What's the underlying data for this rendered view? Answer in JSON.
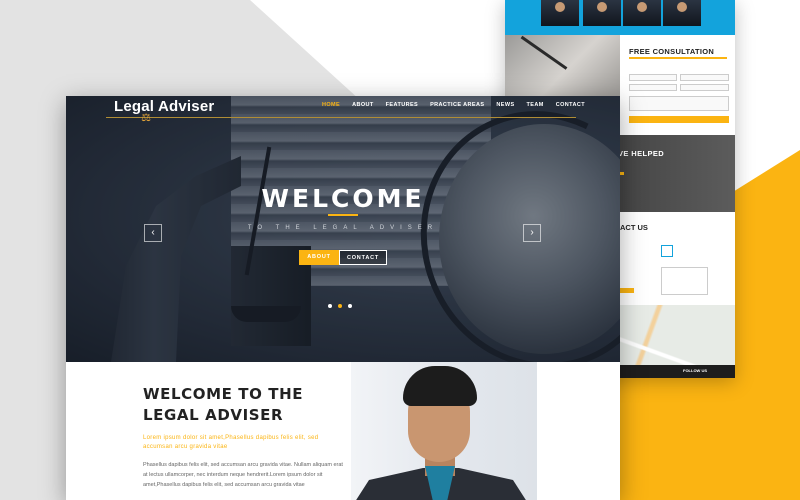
{
  "brand": {
    "name": "Legal Adviser",
    "icon": "scales-icon"
  },
  "nav": {
    "items": [
      {
        "label": "HOME",
        "active": true
      },
      {
        "label": "ABOUT",
        "active": false
      },
      {
        "label": "FEATURES",
        "active": false
      },
      {
        "label": "PRACTICE AREAS",
        "active": false
      },
      {
        "label": "NEWS",
        "active": false
      },
      {
        "label": "TEAM",
        "active": false
      },
      {
        "label": "CONTACT",
        "active": false
      }
    ]
  },
  "hero": {
    "title": "WELCOME",
    "subtitle": "TO THE LEGAL ADVISER",
    "buttons": {
      "about": "ABOUT",
      "contact": "CONTACT"
    },
    "prev_icon": "chevron-left-icon",
    "next_icon": "chevron-right-icon",
    "slides": 3,
    "active_slide": 2
  },
  "intro": {
    "title": "WELCOME TO THE LEGAL ADVISER",
    "lead": "Lorem ipsum dolor sit amet,Phasellus dapibus felis elit, sed accumsan arcu gravida vitae",
    "body": "Phasellus dapibus felis elit, sed accumsan arcu gravida vitae. Nullam aliquam erat at lectus ullamcorper, nec interdum neque hendrerit.Lorem ipsum dolor sit amet,Phasellus dapibus felis elit, sed accumsan arcu gravida vitae"
  },
  "back_page": {
    "consultation_title": "FREE CONSULTATION",
    "helped_title": "VE HELPED",
    "contact_title": "ACT US",
    "footer_label": "FOLLOW US"
  },
  "colors": {
    "accent": "#fbb412",
    "team_band": "#13a3dc",
    "text_dark": "#222222"
  }
}
